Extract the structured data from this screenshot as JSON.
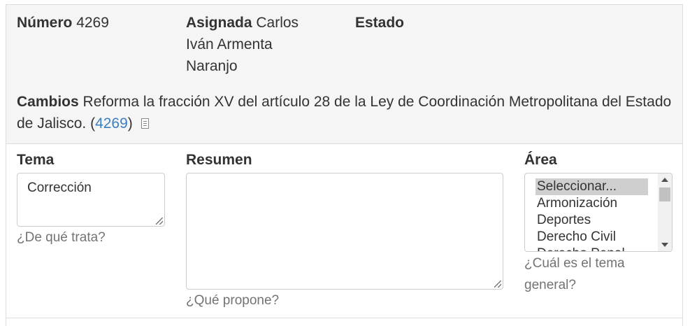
{
  "header": {
    "numero_label": "Número",
    "numero_value": "4269",
    "asignada_label": "Asignada",
    "asignada_value": "Carlos Iván Armenta Naranjo",
    "estado_label": "Estado",
    "estado_value": ""
  },
  "cambios": {
    "label": "Cambios",
    "text": "Reforma la fracción XV del artículo 28 de la Ley de Coordinación Metropolitana del Estado de Jalisco.",
    "link_open": "(",
    "link_text": "4269",
    "link_close": ")",
    "doc_icon": "document-icon"
  },
  "form": {
    "tema": {
      "label": "Tema",
      "value": "Corrección",
      "help": "¿De qué trata?"
    },
    "resumen": {
      "label": "Resumen",
      "value": "",
      "help": "¿Qué propone?"
    },
    "area": {
      "label": "Área",
      "options": [
        "Seleccionar...",
        "Armonización",
        "Deportes",
        "Derecho Civil",
        "Derecho Penal"
      ],
      "selected": "Seleccionar...",
      "help": "¿Cuál es el tema general?"
    }
  },
  "colors": {
    "link": "#3a7fc1",
    "panel_bg": "#f5f5f5",
    "help_text": "#737373"
  }
}
